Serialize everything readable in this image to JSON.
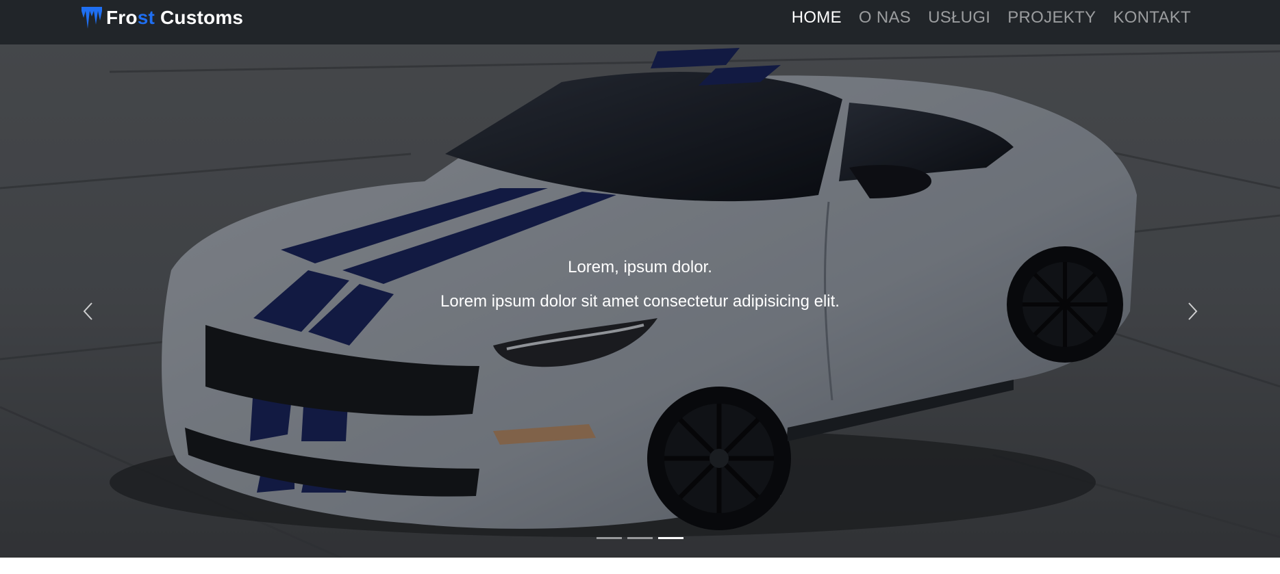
{
  "brand": {
    "name_part1": "Fro",
    "name_part2": "st",
    "name_part3": " Customs",
    "accent_color": "#1f6ff2",
    "logo_icon": "icicle-logo-icon"
  },
  "nav": {
    "items": [
      {
        "label": "HOME",
        "active": true
      },
      {
        "label": "O NAS",
        "active": false
      },
      {
        "label": "USŁUGI",
        "active": false
      },
      {
        "label": "PROJEKTY",
        "active": false
      },
      {
        "label": "KONTAKT",
        "active": false
      }
    ]
  },
  "hero": {
    "caption_title": "Lorem, ipsum dolor.",
    "caption_text": "Lorem ipsum dolor sit amet consectetur adipisicing elit.",
    "prev_icon": "chevron-left-icon",
    "next_icon": "chevron-right-icon",
    "slide_count": 3,
    "active_slide": 3,
    "image_subject": "white sports car with blue racing stripes"
  },
  "colors": {
    "navbar_bg": "#212529",
    "nav_active": "#ffffff",
    "nav_inactive": "rgba(255,255,255,0.55)"
  }
}
